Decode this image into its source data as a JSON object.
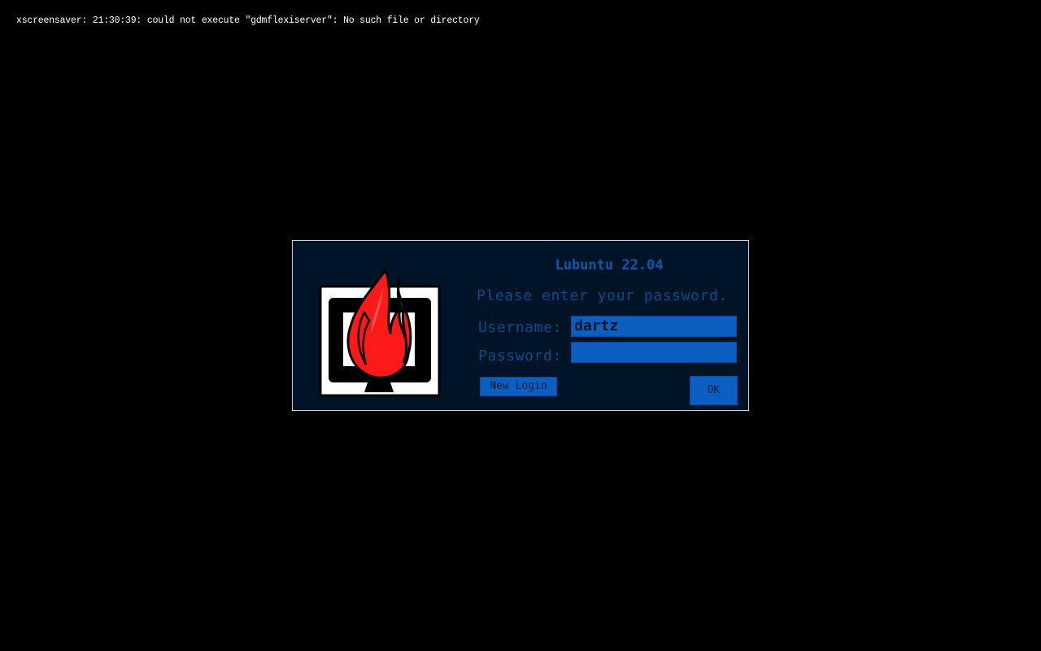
{
  "error_message": "xscreensaver: 21:30:39: could not execute \"gdmflexiserver\": No such file or directory",
  "dialog": {
    "title": "Lubuntu 22.04",
    "prompt": "Please enter your password.",
    "username_label": "Username:",
    "username_value": "dartz",
    "password_label": "Password:",
    "password_value": "",
    "new_login_button": "New Login",
    "ok_button": "OK",
    "logo_icon": "xscreensaver-flame-monitor-icon"
  },
  "colors": {
    "background": "#000000",
    "dialog_background": "#001428",
    "accent": "#0a5fc0",
    "text_dim_blue": "#0b4a8e",
    "flame_red": "#ff0000"
  }
}
